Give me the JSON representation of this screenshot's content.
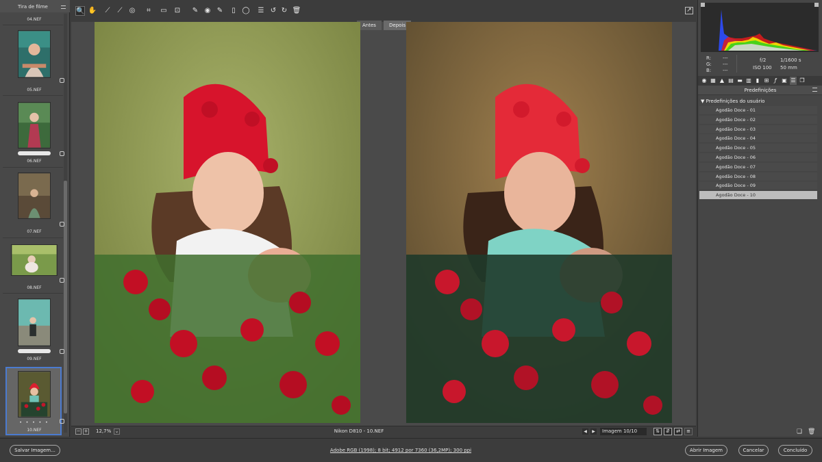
{
  "filmstrip": {
    "title": "Tira de filme",
    "items": [
      {
        "label": "04.NEF"
      },
      {
        "label": "05.NEF"
      },
      {
        "label": "06.NEF"
      },
      {
        "label": "07.NEF"
      },
      {
        "label": "08.NEF"
      },
      {
        "label": "09.NEF"
      },
      {
        "label": "10.NEF",
        "rating": "• • • • •"
      }
    ]
  },
  "toolbar": {
    "tools": [
      {
        "name": "zoom-tool",
        "icon": "magnifier",
        "glyph": "🔍"
      },
      {
        "name": "hand-tool",
        "icon": "hand",
        "glyph": "✋"
      },
      {
        "name": "white-balance-tool",
        "icon": "eyedropper",
        "glyph": "⟋"
      },
      {
        "name": "color-sampler-tool",
        "icon": "eyedropper-plus",
        "glyph": "⟋"
      },
      {
        "name": "targeted-adjustment-tool",
        "icon": "target",
        "glyph": "◎"
      },
      {
        "name": "crop-tool",
        "icon": "crop",
        "glyph": "⌗"
      },
      {
        "name": "straighten-tool",
        "icon": "ruler",
        "glyph": "▭"
      },
      {
        "name": "transform-tool",
        "icon": "transform",
        "glyph": "⊡"
      },
      {
        "name": "spot-removal-tool",
        "icon": "brush",
        "glyph": "✎"
      },
      {
        "name": "red-eye-tool",
        "icon": "eye",
        "glyph": "◉"
      },
      {
        "name": "adjustment-brush-tool",
        "icon": "brush",
        "glyph": "✎"
      },
      {
        "name": "graduated-filter-tool",
        "icon": "gradient",
        "glyph": "▯"
      },
      {
        "name": "radial-filter-tool",
        "icon": "ellipse",
        "glyph": "◯"
      },
      {
        "name": "preferences-tool",
        "icon": "list",
        "glyph": "☰"
      },
      {
        "name": "rotate-left-tool",
        "icon": "rotate-left",
        "glyph": "↺"
      },
      {
        "name": "rotate-right-tool",
        "icon": "rotate-right",
        "glyph": "↻"
      },
      {
        "name": "delete-tool",
        "icon": "trash",
        "glyph": "🗑"
      }
    ],
    "fullscreen_icon": "fullscreen-icon"
  },
  "compare": {
    "before_label": "Antes",
    "after_label": "Depois"
  },
  "status": {
    "zoom": "12,7%",
    "camera_file": "Nikon D810  -  10.NEF",
    "image_counter": "Imagem 10/10"
  },
  "right_panel": {
    "readout": {
      "r_label": "R:",
      "g_label": "G:",
      "b_label": "B:",
      "r_value": "---",
      "g_value": "---",
      "b_value": "---",
      "aperture": "f/2",
      "shutter": "1/1600 s",
      "iso": "ISO 100",
      "focal": "50 mm"
    },
    "panel_title": "Predefinições",
    "group_label": "Predefinições do usuário",
    "presets": [
      {
        "label": "Agodão Doce - 01"
      },
      {
        "label": "Agodão Doce - 02"
      },
      {
        "label": "Agodão Doce - 03"
      },
      {
        "label": "Agodão Doce - 04"
      },
      {
        "label": "Agodão Doce - 05"
      },
      {
        "label": "Agodão Doce - 06"
      },
      {
        "label": "Agodão Doce - 07"
      },
      {
        "label": "Agodão Doce - 08"
      },
      {
        "label": "Agodão Doce - 09"
      },
      {
        "label": "Agodão Doce - 10"
      }
    ],
    "selected_preset": "Agodão Doce - 10"
  },
  "bottom": {
    "save_label": "Salvar Imagem...",
    "workflow_link": "Adobe RGB (1998); 8 bit; 4912 por 7360 (36,2MP); 300 ppi",
    "open_label": "Abrir Imagem",
    "cancel_label": "Cancelar",
    "done_label": "Concluído"
  },
  "colors": {
    "selection_blue": "#4b7bd0",
    "panel_bg": "#464646",
    "preview_bg": "#4a4a4a"
  }
}
